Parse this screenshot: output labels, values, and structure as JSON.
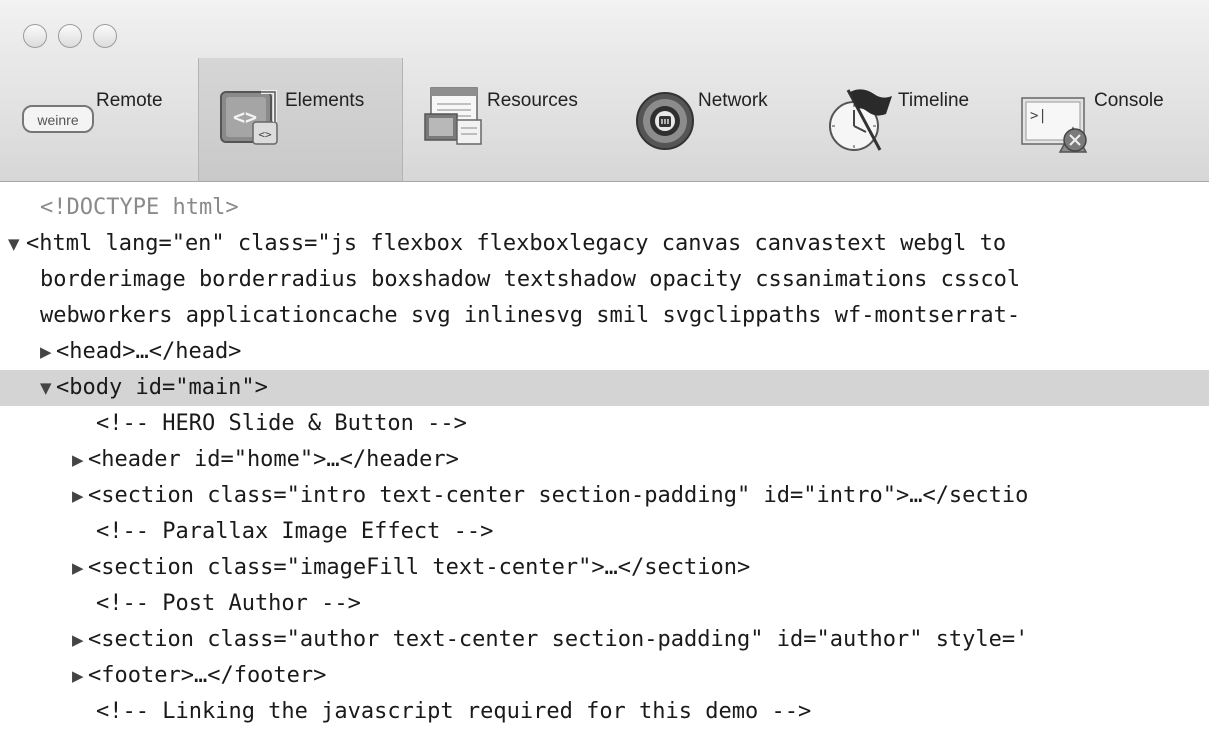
{
  "window": {
    "buttons": [
      "close",
      "minimize",
      "zoom"
    ]
  },
  "toolbar": {
    "active": "Elements",
    "items": [
      {
        "label": "Remote",
        "icon": "weinre-icon",
        "badge": "weinre"
      },
      {
        "label": "Elements",
        "icon": "elements-icon"
      },
      {
        "label": "Resources",
        "icon": "resources-icon"
      },
      {
        "label": "Network",
        "icon": "network-icon"
      },
      {
        "label": "Timeline",
        "icon": "timeline-icon"
      },
      {
        "label": "Console",
        "icon": "console-icon"
      }
    ]
  },
  "tree": {
    "selected_index": 5,
    "lines": [
      {
        "text": "<!DOCTYPE html>",
        "toggle": ""
      },
      {
        "text": "<html lang=\"en\" class=\"js flexbox flexboxlegacy canvas canvastext webgl to",
        "toggle": "▼"
      },
      {
        "text": "borderimage borderradius boxshadow textshadow opacity cssanimations csscol",
        "toggle": ""
      },
      {
        "text": "webworkers applicationcache svg inlinesvg smil svgclippaths wf-montserrat-",
        "toggle": ""
      },
      {
        "text": "<head>…</head>",
        "toggle": "▶"
      },
      {
        "text": "<body id=\"main\">",
        "toggle": "▼"
      },
      {
        "text": "<!-- HERO Slide & Button -->",
        "toggle": ""
      },
      {
        "text": "<header id=\"home\">…</header>",
        "toggle": "▶"
      },
      {
        "text": "<section class=\"intro text-center section-padding\" id=\"intro\">…</sectio",
        "toggle": "▶"
      },
      {
        "text": "<!-- Parallax Image Effect -->",
        "toggle": ""
      },
      {
        "text": "<section class=\"imageFill text-center\">…</section>",
        "toggle": "▶"
      },
      {
        "text": "<!-- Post Author -->",
        "toggle": ""
      },
      {
        "text": "<section class=\"author text-center section-padding\" id=\"author\" style='",
        "toggle": "▶"
      },
      {
        "text": "<footer>…</footer>",
        "toggle": "▶"
      },
      {
        "text": "<!-- Linking the javascript required for this demo -->",
        "toggle": ""
      }
    ]
  }
}
